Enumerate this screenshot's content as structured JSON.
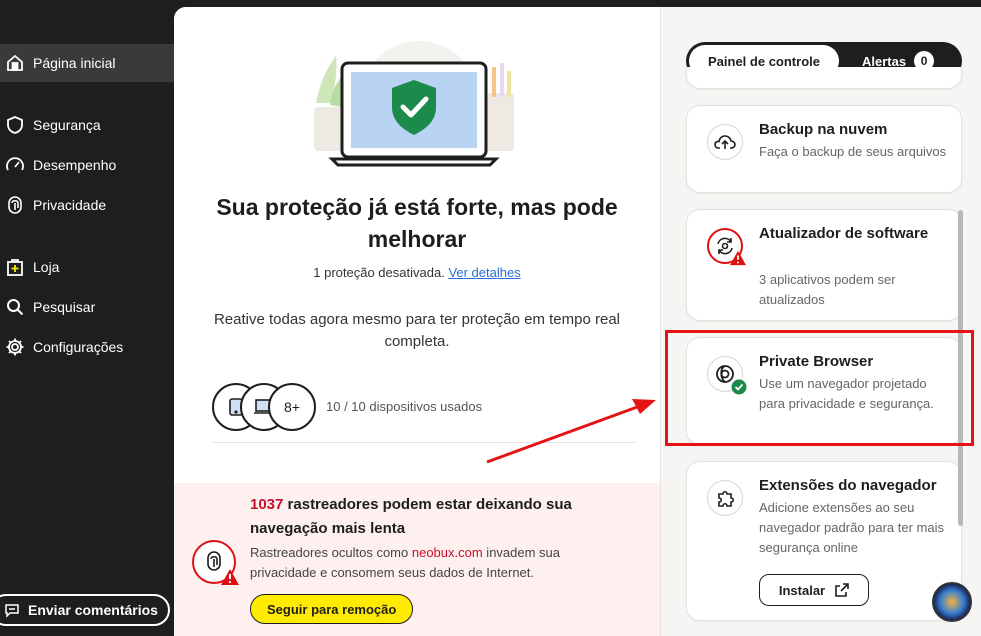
{
  "sidebar": {
    "items": [
      {
        "label": "Página inicial",
        "icon": "home-icon"
      },
      {
        "label": "Segurança",
        "icon": "shield-icon"
      },
      {
        "label": "Desempenho",
        "icon": "speedometer-icon"
      },
      {
        "label": "Privacidade",
        "icon": "fingerprint-icon"
      },
      {
        "label": "Loja",
        "icon": "store-icon"
      },
      {
        "label": "Pesquisar",
        "icon": "search-icon"
      },
      {
        "label": "Configurações",
        "icon": "gear-icon"
      }
    ],
    "feedback_label": "Enviar comentários"
  },
  "main": {
    "headline": "Sua proteção já está forte, mas pode melhorar",
    "status_text": "1 proteção desativada.",
    "details_link": "Ver detalhes",
    "reactivate_text": "Reative todas agora mesmo para ter proteção em tempo real completa.",
    "devices_more": "8+",
    "devices_text": "10 / 10 dispositivos usados"
  },
  "trackers": {
    "count": "1037",
    "title_rest": " rastreadores podem estar deixando sua navegação mais lenta",
    "body_prefix": "Rastreadores ocultos como ",
    "site": "neobux.com",
    "body_suffix": " invadem sua privacidade e consomem seus dados de Internet.",
    "button": "Seguir para remoção"
  },
  "right_panel": {
    "tab_dashboard": "Painel de controle",
    "tab_alerts": "Alertas",
    "alerts_count": "0",
    "cards": [
      {
        "title": "Backup na nuvem",
        "desc": "Faça o backup de seus arquivos",
        "icon": "cloud-upload-icon"
      },
      {
        "title": "Atualizador de software",
        "desc": "3 aplicativos podem ser atualizados",
        "icon": "refresh-icon"
      },
      {
        "title": "Private Browser",
        "desc": "Use um navegador projetado para privacidade e segurança.",
        "icon": "browser-icon"
      },
      {
        "title": "Extensões do navegador",
        "desc": "Adicione extensões ao seu navegador padrão para ter mais segurança online",
        "icon": "puzzle-icon"
      }
    ],
    "install_label": "Instalar"
  },
  "colors": {
    "accent_red": "#c8102e",
    "yellow": "#ffeb00",
    "highlight": "#e41414"
  }
}
